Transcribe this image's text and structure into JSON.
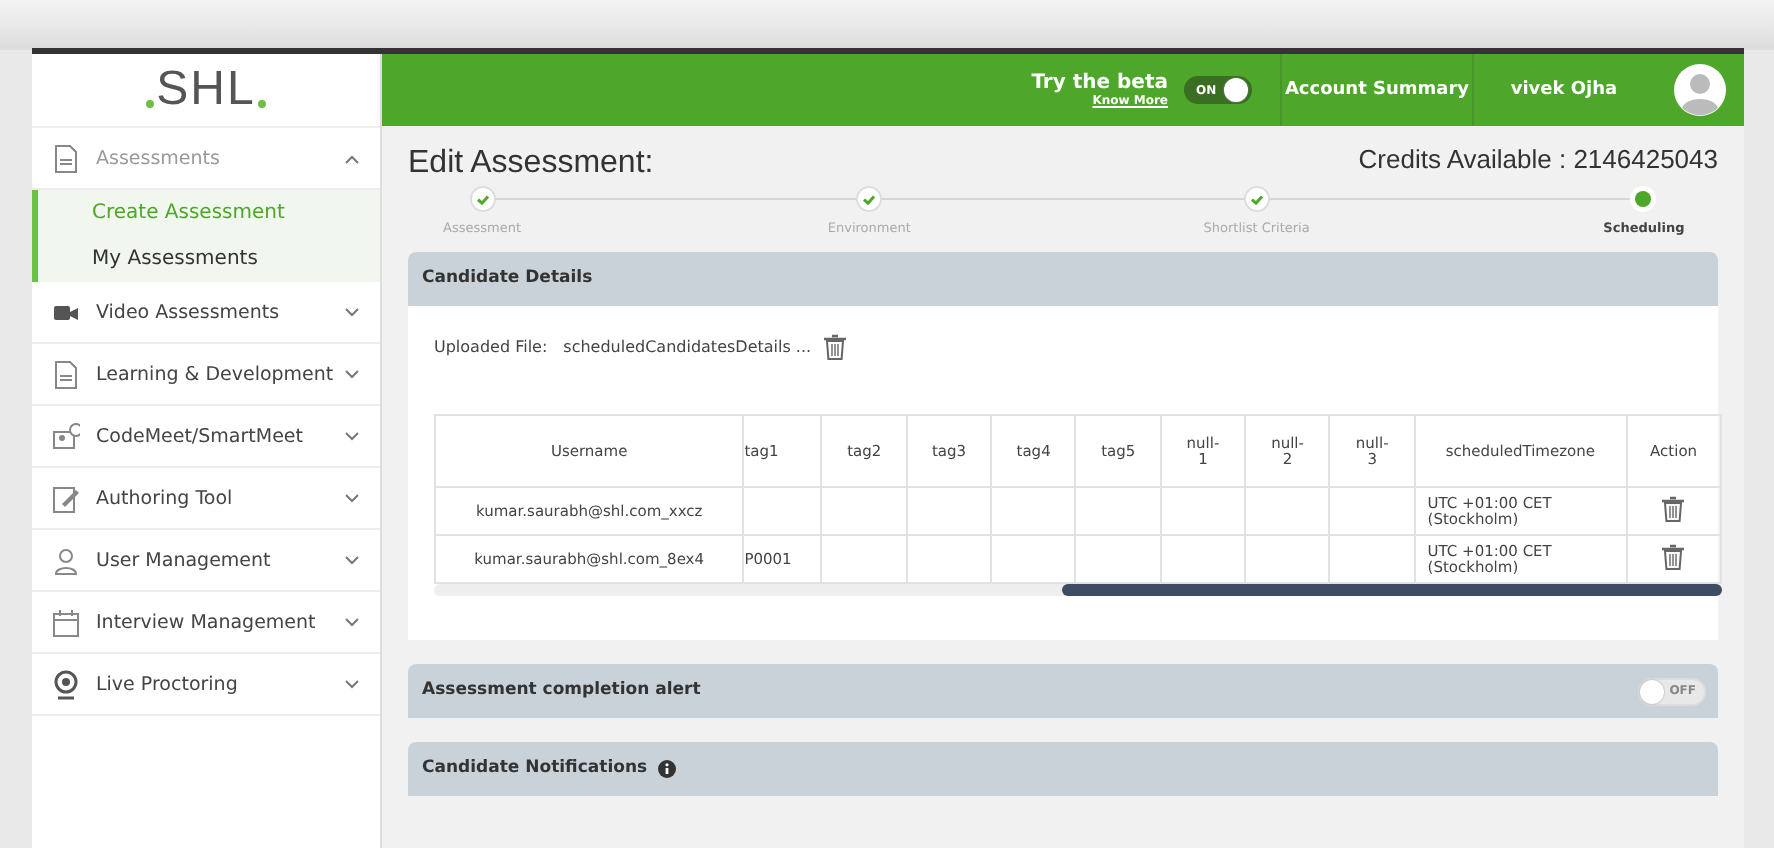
{
  "header": {
    "logo": "SHL",
    "beta": {
      "label": "Try the beta",
      "link": "Know More",
      "toggle": {
        "label": "ON",
        "on": true
      }
    },
    "account_summary": "Account Summary",
    "user_name": "vivek Ojha"
  },
  "sidebar": {
    "items": [
      {
        "label": "Assessments",
        "expanded": true,
        "children": [
          {
            "label": "Create Assessment",
            "selected": true
          },
          {
            "label": "My Assessments",
            "selected": false
          }
        ]
      },
      {
        "label": "Video Assessments",
        "expanded": false
      },
      {
        "label": "Learning & Development",
        "expanded": false
      },
      {
        "label": "CodeMeet/SmartMeet",
        "expanded": false
      },
      {
        "label": "Authoring Tool",
        "expanded": false
      },
      {
        "label": "User Management",
        "expanded": false
      },
      {
        "label": "Interview Management",
        "expanded": false
      },
      {
        "label": "Live Proctoring",
        "expanded": false
      }
    ]
  },
  "page": {
    "title": "Edit Assessment:",
    "credits": "Credits Available : 2146425043"
  },
  "steps": [
    {
      "label": "Assessment",
      "completed": true,
      "selected": false
    },
    {
      "label": "Environment",
      "completed": true,
      "selected": false
    },
    {
      "label": "Shortlist Criteria",
      "completed": true,
      "selected": false
    },
    {
      "label": "Scheduling",
      "completed": false,
      "selected": true
    }
  ],
  "candidate_details": {
    "title": "Candidate Details",
    "uploaded_label": "Uploaded File:",
    "uploaded_file": "scheduledCandidatesDetails ...",
    "table": {
      "columns": [
        "Username",
        "tag1",
        "tag2",
        "tag3",
        "tag4",
        "tag5",
        "null-\n1",
        "null-\n2",
        "null-\n3",
        "scheduledTimezone",
        "Action"
      ],
      "rows": [
        [
          "kumar.saurabh@shl.com_xxcz",
          "",
          "",
          "",
          "",
          "",
          "",
          "",
          "",
          "UTC +01:00 CET (Stockholm)"
        ],
        [
          "kumar.saurabh@shl.com_8ex4",
          "P0001",
          "",
          "",
          "",
          "",
          "",
          "",
          "",
          "UTC +01:00 CET (Stockholm)"
        ]
      ]
    }
  },
  "completion_alert": {
    "title": "Assessment completion alert",
    "toggle": {
      "label": "OFF",
      "on": false
    }
  },
  "candidate_notifications": {
    "title": "Candidate Notifications"
  }
}
